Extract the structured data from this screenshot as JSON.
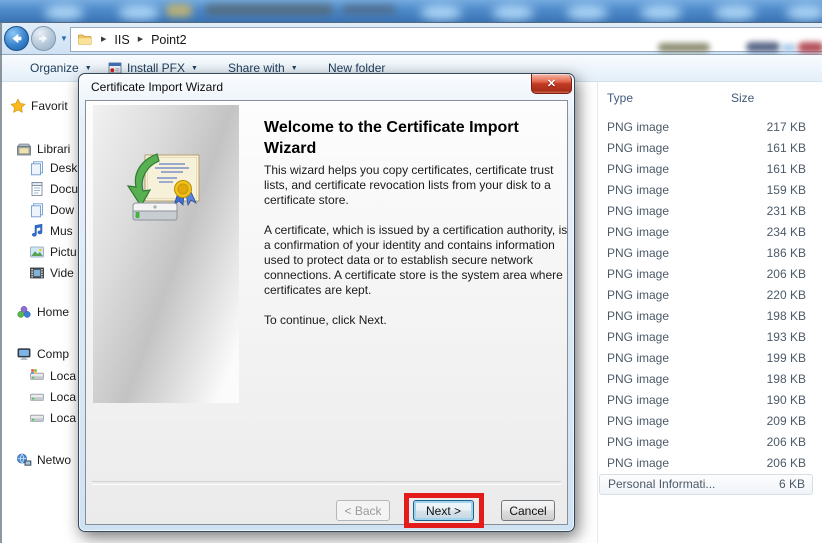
{
  "explorer": {
    "address": {
      "breadcrumb": [
        "IIS",
        "Point2"
      ]
    },
    "toolbar": {
      "organize": "Organize",
      "install_pfx": "Install PFX",
      "share_with": "Share with",
      "new_folder": "New folder"
    },
    "sidebar": {
      "items": [
        {
          "label": "Favorit",
          "icon": "star-icon"
        },
        {
          "label": "Librari",
          "icon": "library-icon"
        },
        {
          "label": "Desk",
          "icon": "pages-icon"
        },
        {
          "label": "Docu",
          "icon": "document-icon"
        },
        {
          "label": "Dow",
          "icon": "pages-icon"
        },
        {
          "label": "Mus",
          "icon": "music-note-icon"
        },
        {
          "label": "Pictu",
          "icon": "picture-icon"
        },
        {
          "label": "Vide",
          "icon": "film-icon"
        },
        {
          "label": "Home",
          "icon": "homegroup-icon"
        },
        {
          "label": "Comp",
          "icon": "computer-icon"
        },
        {
          "label": "Loca",
          "icon": "os-disk-icon"
        },
        {
          "label": "Loca",
          "icon": "disk-icon"
        },
        {
          "label": "Loca",
          "icon": "disk-icon"
        },
        {
          "label": "Netwo",
          "icon": "network-icon"
        }
      ]
    },
    "file_list": {
      "columns": [
        "Type",
        "Size"
      ],
      "rows": [
        {
          "type": "PNG image",
          "size": "217 KB"
        },
        {
          "type": "PNG image",
          "size": "161 KB"
        },
        {
          "type": "PNG image",
          "size": "161 KB"
        },
        {
          "type": "PNG image",
          "size": "159 KB"
        },
        {
          "type": "PNG image",
          "size": "231 KB"
        },
        {
          "type": "PNG image",
          "size": "234 KB"
        },
        {
          "type": "PNG image",
          "size": "186 KB"
        },
        {
          "type": "PNG image",
          "size": "206 KB"
        },
        {
          "type": "PNG image",
          "size": "220 KB"
        },
        {
          "type": "PNG image",
          "size": "198 KB"
        },
        {
          "type": "PNG image",
          "size": "193 KB"
        },
        {
          "type": "PNG image",
          "size": "199 KB"
        },
        {
          "type": "PNG image",
          "size": "198 KB"
        },
        {
          "type": "PNG image",
          "size": "190 KB"
        },
        {
          "type": "PNG image",
          "size": "209 KB"
        },
        {
          "type": "PNG image",
          "size": "206 KB"
        },
        {
          "type": "PNG image",
          "size": "206 KB"
        },
        {
          "type": "Personal Informati...",
          "size": "6 KB"
        }
      ]
    }
  },
  "dialog": {
    "title": "Certificate Import Wizard",
    "heading": "Welcome to the Certificate Import Wizard",
    "paragraphs": [
      "This wizard helps you copy certificates, certificate trust lists, and certificate revocation lists from your disk to a certificate store.",
      "A certificate, which is issued by a certification authority, is a confirmation of your identity and contains information used to protect data or to establish secure network connections. A certificate store is the system area where certificates are kept.",
      "To continue, click Next."
    ],
    "buttons": [
      {
        "label": "< Back",
        "enabled": false
      },
      {
        "label": "Next >",
        "enabled": true,
        "focused": true,
        "highlighted": true
      },
      {
        "label": "Cancel",
        "enabled": true
      }
    ],
    "highlight_color": "#e31b1b"
  },
  "icons": {
    "close": "✕",
    "caret": "▼",
    "breadcrumb_arrow": "▶",
    "nav_dropdown": "▼"
  }
}
